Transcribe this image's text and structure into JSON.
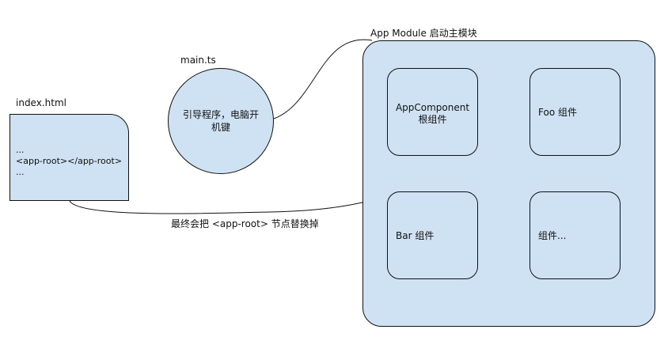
{
  "index": {
    "title": "index.html",
    "lines": [
      "...",
      "<app-root></app-root>",
      "..."
    ]
  },
  "main": {
    "title": "main.ts",
    "text": "引导程序，电脑开机键"
  },
  "module": {
    "title": "App Module 启动主模块",
    "components": [
      {
        "line1": "AppComponent",
        "line2": "根组件"
      },
      {
        "line1": "Foo 组件",
        "line2": ""
      },
      {
        "line1": "Bar 组件",
        "line2": ""
      },
      {
        "line1": "组件...",
        "line2": ""
      }
    ]
  },
  "connector": {
    "replace_label": "最终会把 <app-root> 节点替换掉"
  },
  "colors": {
    "fill": "#cfe2f3",
    "stroke": "#111111"
  }
}
